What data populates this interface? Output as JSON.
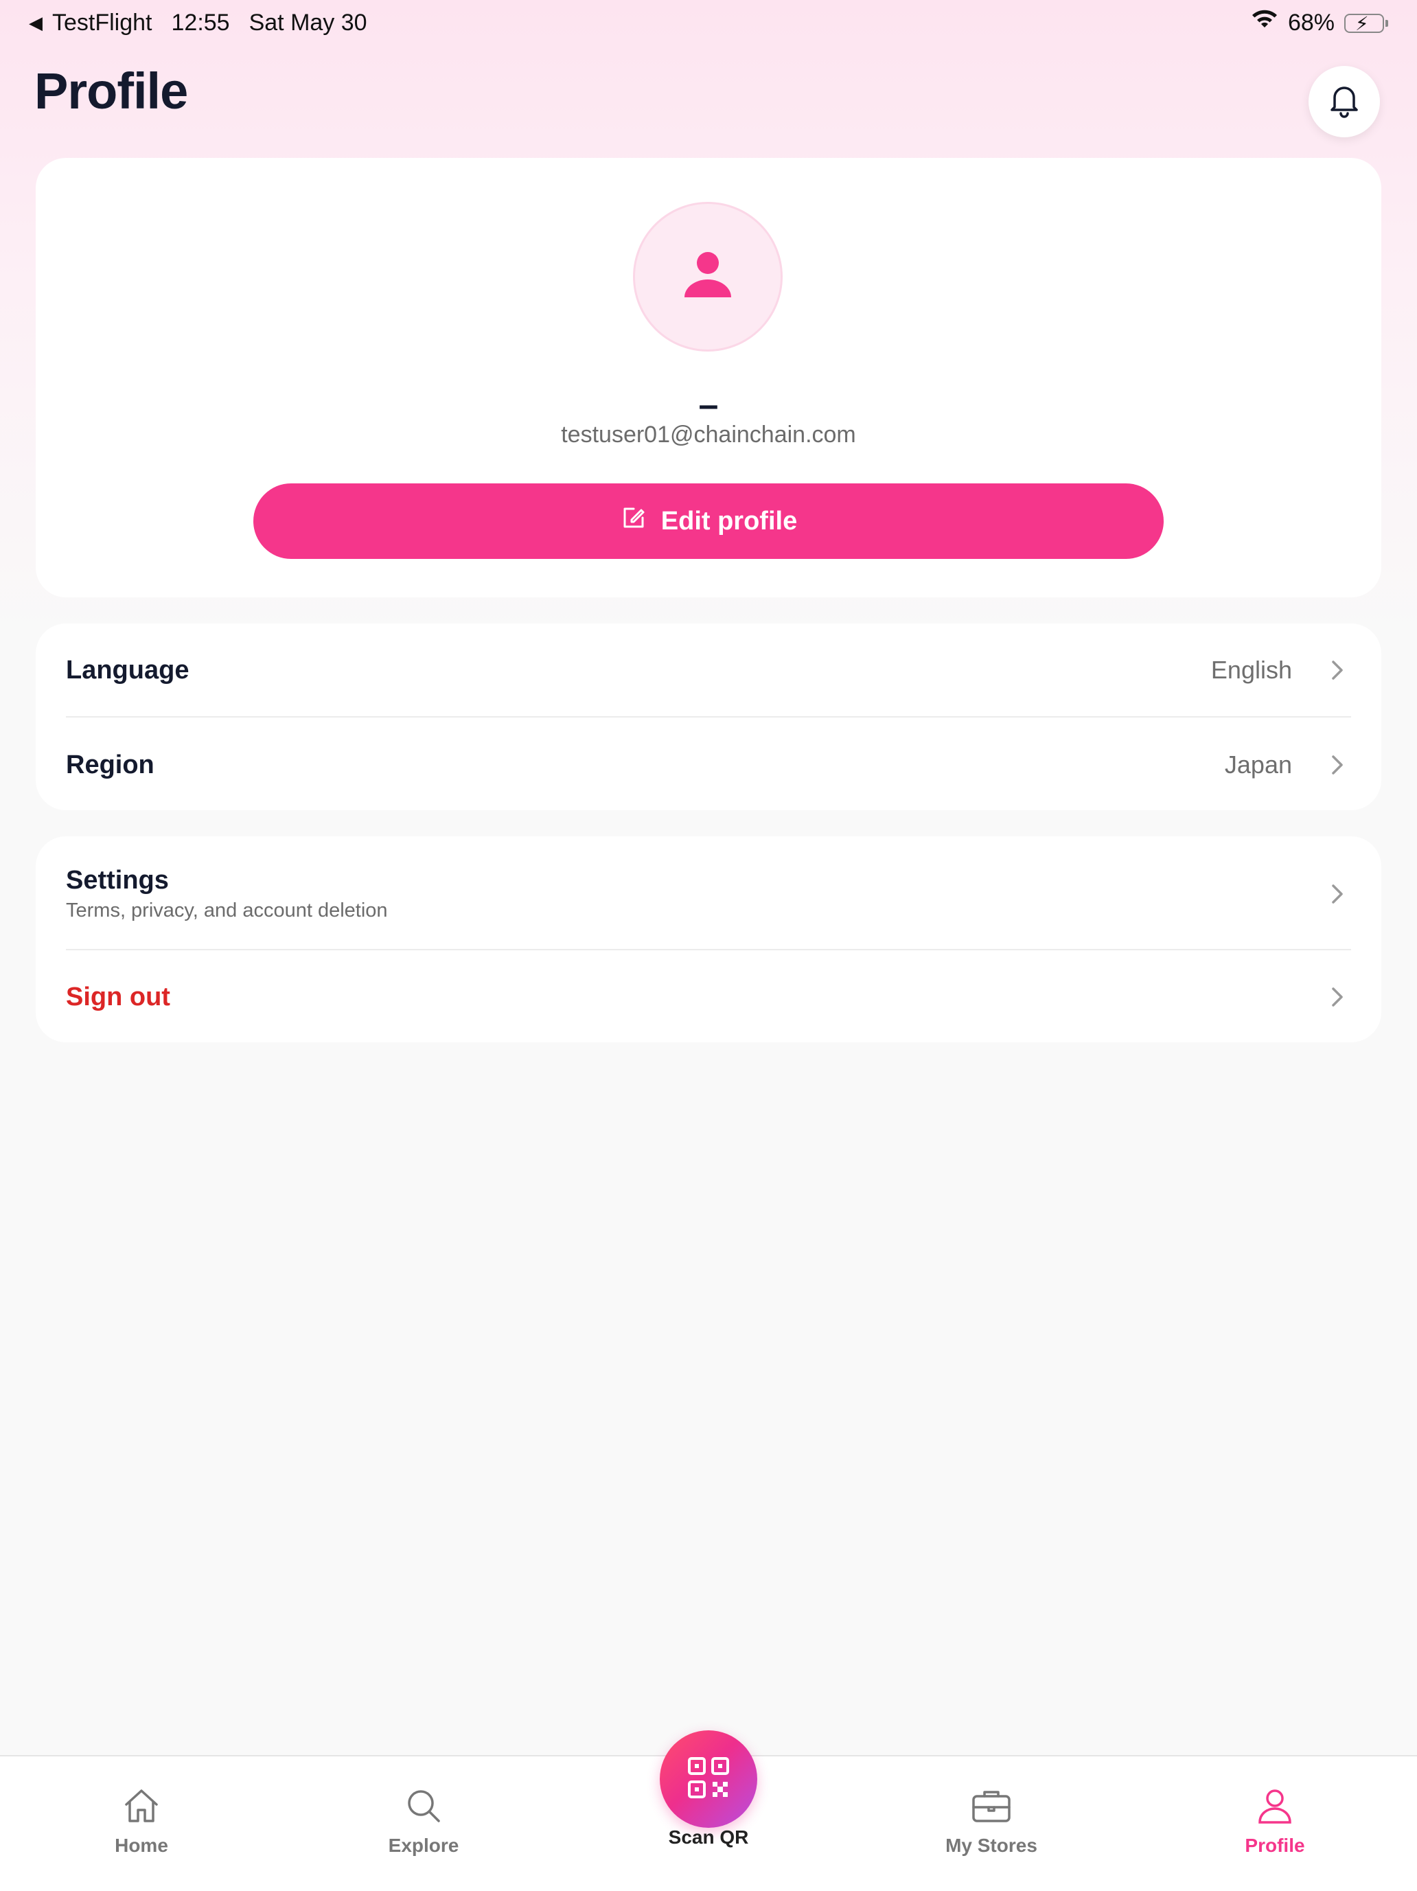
{
  "status_bar": {
    "back_app": "TestFlight",
    "time": "12:55",
    "date": "Sat May 30",
    "battery_pct": "68%",
    "battery_level": 0.68
  },
  "header": {
    "title": "Profile"
  },
  "profile": {
    "name": "–",
    "email": "testuser01@chainchain.com",
    "edit_label": "Edit profile"
  },
  "preferences": [
    {
      "label": "Language",
      "value": "English"
    },
    {
      "label": "Region",
      "value": "Japan"
    }
  ],
  "account": {
    "settings_label": "Settings",
    "settings_sub": "Terms, privacy, and account deletion",
    "signout_label": "Sign out"
  },
  "tabs": [
    {
      "label": "Home",
      "icon": "home-icon"
    },
    {
      "label": "Explore",
      "icon": "search-icon"
    },
    {
      "label": "Scan QR",
      "icon": "qr-code-icon"
    },
    {
      "label": "My Stores",
      "icon": "briefcase-icon"
    },
    {
      "label": "Profile",
      "icon": "user-icon",
      "active": true
    }
  ],
  "colors": {
    "accent": "#f5368b",
    "danger": "#dc2626",
    "title": "#141a2e"
  }
}
